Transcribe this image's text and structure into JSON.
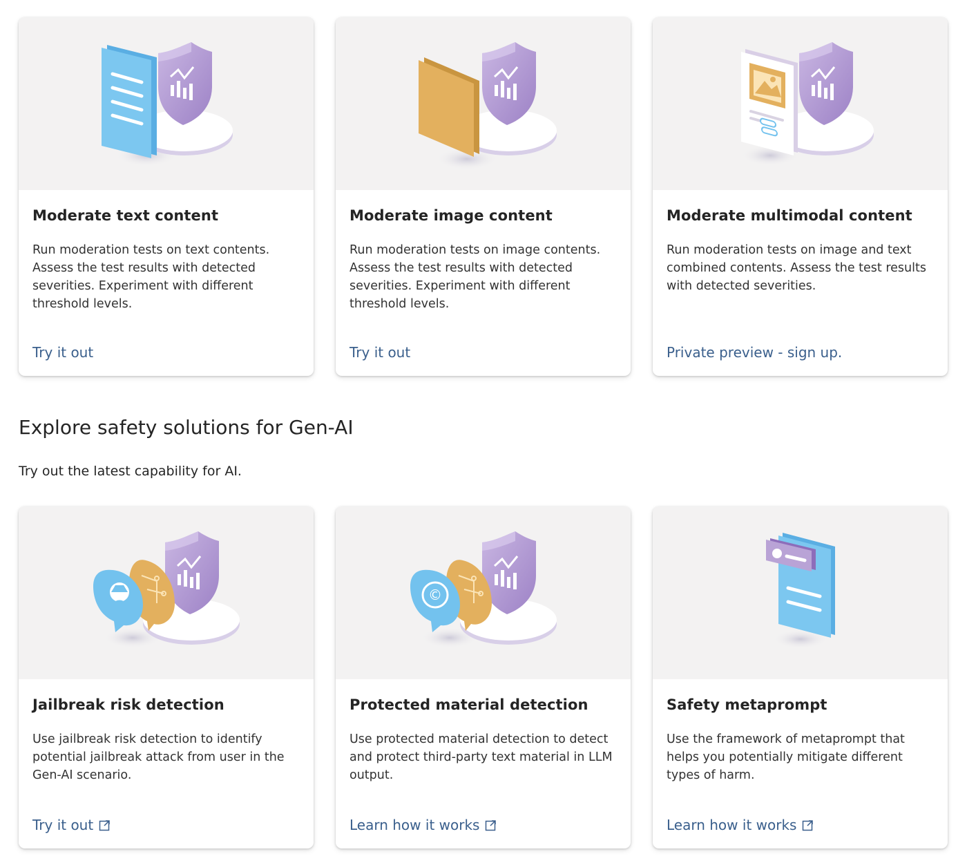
{
  "row1": [
    {
      "title": "Moderate text content",
      "description": "Run moderation tests on text contents. Assess the test results with detected severities. Experiment with different threshold levels.",
      "link": "Try it out",
      "external": false,
      "art": "text-document-shield"
    },
    {
      "title": "Moderate image content",
      "description": "Run moderation tests on image contents. Assess the test results with detected severities. Experiment with different threshold levels.",
      "link": "Try it out",
      "external": false,
      "art": "image-card-shield"
    },
    {
      "title": "Moderate multimodal content",
      "description": "Run moderation tests on image and text combined contents. Assess the test results with detected severities.",
      "link": "Private preview - sign up.",
      "external": false,
      "art": "multimodal-card-shield"
    }
  ],
  "section": {
    "title": "Explore safety solutions for Gen-AI",
    "subtitle": "Try out the latest capability for AI."
  },
  "row2": [
    {
      "title": "Jailbreak risk detection",
      "description": "Use jailbreak risk detection to identify potential jailbreak attack from user in the Gen-AI scenario.",
      "link": "Try it out",
      "external": true,
      "art": "jailbreak-bubbles-shield"
    },
    {
      "title": "Protected material detection",
      "description": "Use protected material detection to detect and protect third-party text material in LLM output.",
      "link": "Learn how it works",
      "external": true,
      "art": "copyright-bubbles-shield"
    },
    {
      "title": "Safety metaprompt",
      "description": "Use the framework of metaprompt that helps you potentially mitigate different types of harm.",
      "link": "Learn how it works",
      "external": true,
      "art": "metaprompt-document"
    }
  ],
  "colors": {
    "link": "#3a5f8c",
    "card_art_bg": "#f3f2f2",
    "shield_purple": "#b9a3d6",
    "doc_blue": "#73c2ee",
    "image_orange": "#e3b05e"
  }
}
